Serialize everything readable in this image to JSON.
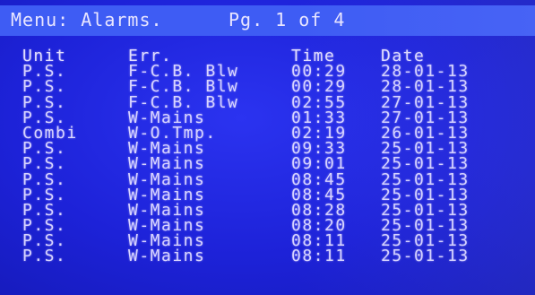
{
  "header": {
    "title": "Menu: Alarms.",
    "page": "Pg. 1 of 4"
  },
  "table": {
    "columns": [
      "Unit",
      "Err.",
      "Time",
      "Date"
    ],
    "rows": [
      [
        "P.S.",
        "F-C.B. Blw",
        "00:29",
        "28-01-13"
      ],
      [
        "P.S.",
        "F-C.B. Blw",
        "00:29",
        "28-01-13"
      ],
      [
        "P.S.",
        "F-C.B. Blw",
        "02:55",
        "27-01-13"
      ],
      [
        "P.S.",
        "W-Mains",
        "01:33",
        "27-01-13"
      ],
      [
        "Combi",
        "W-O.Tmp.",
        "02:19",
        "26-01-13"
      ],
      [
        "P.S.",
        "W-Mains",
        "09:33",
        "25-01-13"
      ],
      [
        "P.S.",
        "W-Mains",
        "09:01",
        "25-01-13"
      ],
      [
        "P.S.",
        "W-Mains",
        "08:45",
        "25-01-13"
      ],
      [
        "P.S.",
        "W-Mains",
        "08:45",
        "25-01-13"
      ],
      [
        "P.S.",
        "W-Mains",
        "08:28",
        "25-01-13"
      ],
      [
        "P.S.",
        "W-Mains",
        "08:20",
        "25-01-13"
      ],
      [
        "P.S.",
        "W-Mains",
        "08:11",
        "25-01-13"
      ],
      [
        "P.S.",
        "W-Mains",
        "08:11",
        "25-01-13"
      ]
    ]
  },
  "colors": {
    "background": "#1d22d8",
    "header_bar": "#3e5cf4",
    "text": "#d8d4ff"
  }
}
